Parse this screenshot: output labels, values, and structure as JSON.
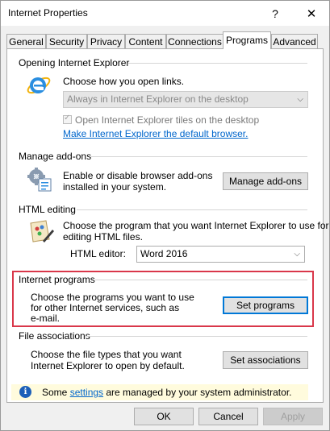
{
  "window": {
    "title": "Internet Properties",
    "help_glyph": "?",
    "close_glyph": "✕"
  },
  "tabs": [
    {
      "label": "General"
    },
    {
      "label": "Security"
    },
    {
      "label": "Privacy"
    },
    {
      "label": "Content"
    },
    {
      "label": "Connections"
    },
    {
      "label": "Programs",
      "active": true
    },
    {
      "label": "Advanced"
    }
  ],
  "opening_ie": {
    "title": "Opening Internet Explorer",
    "description": "Choose how you open links.",
    "dropdown_value": "Always in Internet Explorer on the desktop",
    "checkbox_label": "Open Internet Explorer tiles on the desktop",
    "checkbox_checked": true,
    "default_link": "Make Internet Explorer the default browser."
  },
  "addons": {
    "title": "Manage add-ons",
    "description_line1": "Enable or disable browser add-ons",
    "description_line2": "installed in your system.",
    "button": "Manage add-ons"
  },
  "html_editing": {
    "title": "HTML editing",
    "description_line1": "Choose the program that you want Internet Explorer to use for",
    "description_line2": "editing HTML files.",
    "editor_label": "HTML editor:",
    "editor_value": "Word 2016"
  },
  "internet_programs": {
    "title": "Internet programs",
    "description_line1": "Choose the programs you want to use",
    "description_line2": "for other Internet services, such as",
    "description_line3": "e-mail.",
    "button": "Set programs"
  },
  "file_associations": {
    "title": "File associations",
    "description_line1": "Choose the file types that you want",
    "description_line2": "Internet Explorer to open by default.",
    "button": "Set associations"
  },
  "info_bar": {
    "prefix": "Some ",
    "link": "settings",
    "suffix": " are managed by your system administrator."
  },
  "footer": {
    "ok": "OK",
    "cancel": "Cancel",
    "apply": "Apply"
  },
  "colors": {
    "highlight_border": "#d9374a",
    "link": "#0066cc",
    "info_background": "#fffbdd",
    "focus": "#0078d7"
  }
}
